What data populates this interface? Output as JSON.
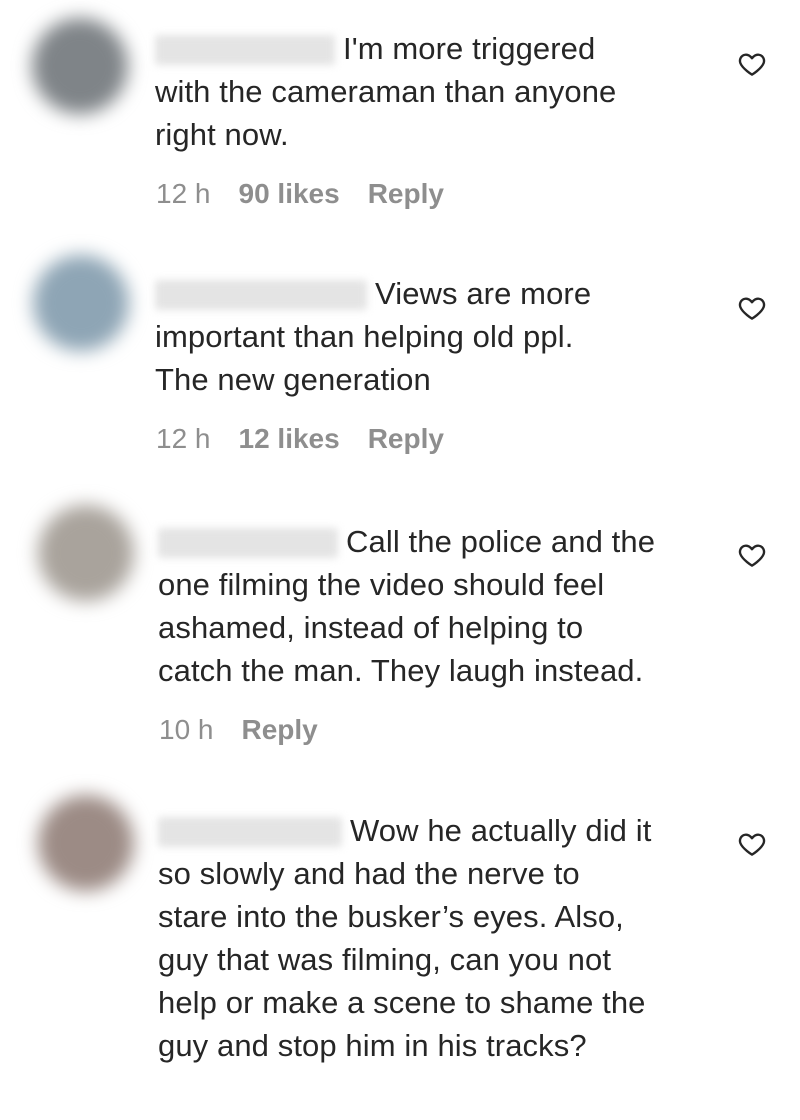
{
  "comments": [
    {
      "avatar_color": "#7f8488",
      "lines": [
        "I'm more triggered",
        "with the cameraman than anyone",
        "right now."
      ],
      "time": "12 h",
      "likes": "90 likes",
      "reply": "Reply"
    },
    {
      "avatar_color": "#8ea5b5",
      "lines": [
        "Views are more",
        "important than helping old ppl.",
        "The new generation"
      ],
      "time": "12 h",
      "likes": "12 likes",
      "reply": "Reply"
    },
    {
      "avatar_color": "#a9a39c",
      "lines": [
        "Call the police and the",
        "one filming the video should feel",
        "ashamed, instead of helping to",
        "catch the man. They laugh instead."
      ],
      "time": "10 h",
      "reply": "Reply"
    },
    {
      "avatar_color": "#9c8b85",
      "lines": [
        "Wow he actually did it",
        "so slowly and had the nerve to",
        "stare into the busker’s eyes. Also,",
        "guy that was filming, can you not",
        "help or make a scene to shame the",
        "guy and stop him in his tracks?"
      ]
    }
  ],
  "icons": {
    "like": "heart-outline-icon"
  }
}
